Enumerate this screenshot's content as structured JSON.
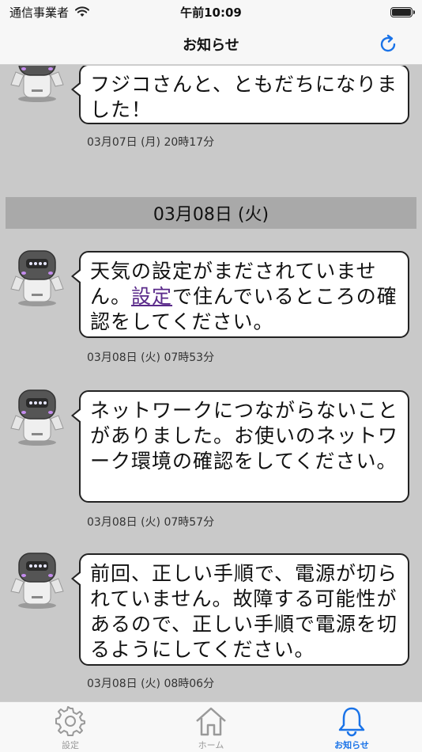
{
  "status_bar": {
    "carrier": "通信事業者",
    "time": "午前10:09"
  },
  "nav": {
    "title": "お知らせ"
  },
  "messages_top": {
    "text": "フジコさんと、ともだちになりました！",
    "timestamp": "03月07日 (月) 20時17分"
  },
  "date_header": "03月08日 (火)",
  "messages": [
    {
      "text_before": "天気の設定がまだされていません。",
      "link": "設定",
      "text_after": "で住んでいるところの確認をしてください。",
      "timestamp": "03月08日 (火) 07時53分"
    },
    {
      "text": "ネットワークにつながらないことがありました。お使いのネットワーク環境の確認をしてください。",
      "timestamp": "03月08日 (火) 07時57分"
    },
    {
      "text": "前回、正しい手順で、電源が切られていません。故障する可能性があるので、正しい手順で電源を切るようにしてください。",
      "timestamp": "03月08日 (火) 08時06分"
    }
  ],
  "tabs": [
    {
      "label": "設定",
      "icon": "gear-icon",
      "active": false
    },
    {
      "label": "ホーム",
      "icon": "home-icon",
      "active": false
    },
    {
      "label": "お知らせ",
      "icon": "bell-icon",
      "active": true
    }
  ],
  "colors": {
    "accent": "#1a73e8",
    "background": "#c9c9c9",
    "header_band": "#a9a9a9",
    "link": "#5a2a8a"
  }
}
